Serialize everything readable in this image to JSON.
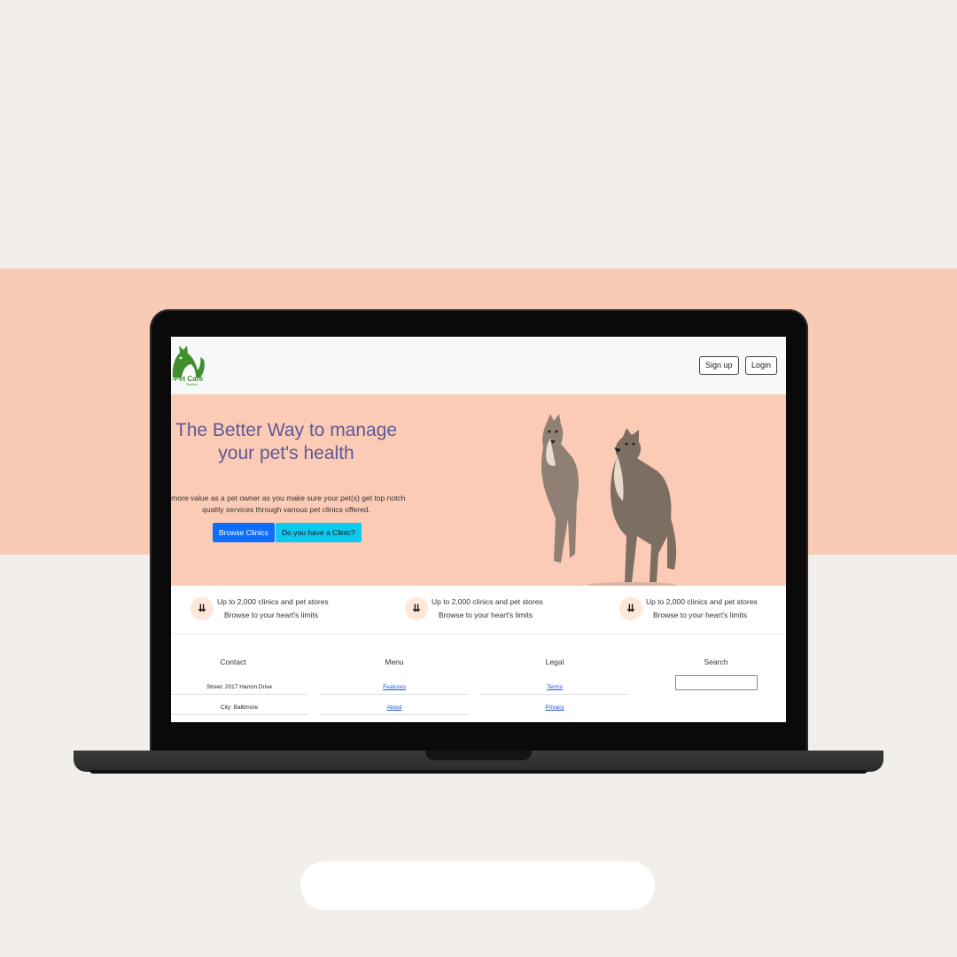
{
  "site": {
    "logo_text": "-Pet Care",
    "logo_subtext": "System"
  },
  "nav": {
    "signup_label": "Sign up",
    "login_label": "Login"
  },
  "hero": {
    "title_line1": "The Better Way to manage",
    "title_line2": "your pet's health",
    "text_line1": "t more value as a pet owner as you make sure your pet(s) get top notch",
    "text_line2": "quality services through various pet clinics offered.",
    "browse_label": "Browse Clinics",
    "clinic_label": "Do you have a Clinic?",
    "image_name": "two-wolves-image"
  },
  "features": [
    {
      "line1": "Up to 2,000 clinics and pet stores",
      "line2": "Browse to your heart's limits",
      "icon": "double-chevron-down-icon"
    },
    {
      "line1": "Up to 2,000 clinics and pet stores",
      "line2": "Browse to your heart's limits",
      "icon": "double-chevron-down-icon"
    },
    {
      "line1": "Up to 2,000 clinics and pet stores",
      "line2": "Browse to your heart's limits",
      "icon": "double-chevron-down-icon"
    }
  ],
  "footer": {
    "contact": {
      "heading": "Contact",
      "street": "Street: 2017 Harron Drive",
      "city": "City: Baltimore"
    },
    "menu": {
      "heading": "Menu",
      "features": "Features",
      "about": "About"
    },
    "legal": {
      "heading": "Legal",
      "terms": "Terms",
      "privacy": "Privacy"
    },
    "search": {
      "heading": "Search",
      "placeholder": ""
    }
  },
  "colors": {
    "page_bg": "#f2efea",
    "band": "#f8cbb6",
    "hero_bg": "#fccbb6",
    "title": "#5d5a96",
    "primary_button": "#0d6efd",
    "info_button": "#0dcaf0",
    "logo_green": "#3f8f2c"
  }
}
